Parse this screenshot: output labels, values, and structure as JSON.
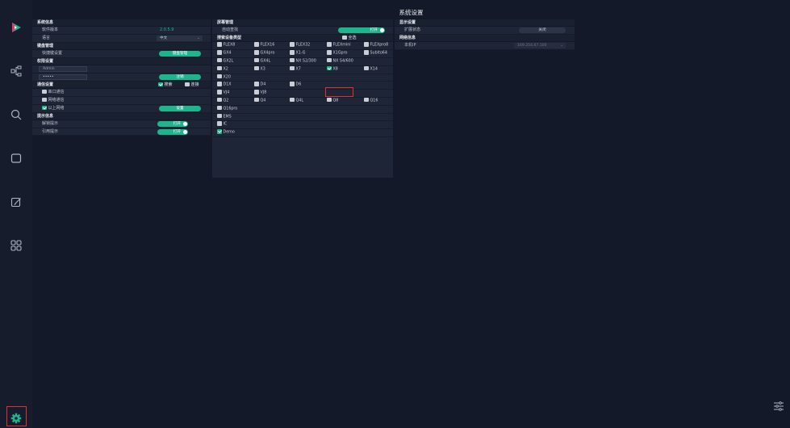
{
  "title": "系统设置",
  "colors": {
    "accent": "#1db58e",
    "bg": "#131928",
    "panel": "#1e2537",
    "highlight": "#e03030"
  },
  "sidebar": {
    "icons": [
      "play-logo-icon",
      "network-tree-icon",
      "search-icon",
      "screen-icon",
      "edit-icon",
      "grid-icon"
    ],
    "settings_icon": "gear-icon"
  },
  "left_panel": {
    "system_info": {
      "header": "系统信息",
      "version_label": "软件版本",
      "version_value": "2.0.5.9",
      "language_label": "语言",
      "language_value": "中文"
    },
    "shortcut": {
      "header": "键盘管理",
      "label": "快捷键设置",
      "button": "键盘管理"
    },
    "permission": {
      "header": "权限设置",
      "username": "Admin",
      "password": "•••••",
      "button": "注销"
    },
    "comm": {
      "header": "通信设置",
      "opt_search": "搜索",
      "opt_connect": "连接",
      "serial": "串口通信",
      "network": "网络通信",
      "ethernet": "以上网络",
      "button": "设置"
    },
    "tips": {
      "header": "提示信息",
      "unlock_label": "解锁提示",
      "unlock_state": "打开",
      "quote_label": "引用提示",
      "quote_state": "打开"
    }
  },
  "mid_panel": {
    "screen_header": "屏幕管理",
    "auto_label": "自动查找",
    "auto_state": "打开",
    "device_header": "搜索设备类型",
    "select_all": "全选",
    "rows": [
      [
        "FLEX8",
        "FLEX16",
        "FLEX32",
        "FLEXmini",
        "FLEXpro8"
      ],
      [
        "GX4",
        "GX4pro",
        "X1-G",
        "X1Gpro",
        "Subito64"
      ],
      [
        "GX2L",
        "GX4L",
        "NX S2/300",
        "NX S4/600"
      ],
      [
        "X2",
        "X3",
        "X7",
        "X8",
        "X14"
      ],
      [
        "X20"
      ],
      [
        "D1X",
        "D4",
        "D6"
      ],
      [
        "VJ4",
        "VJ8"
      ],
      [
        "Q2",
        "Q4",
        "Q4L",
        "Q8",
        "Q16"
      ],
      [
        "Q16pro"
      ],
      [
        "EMS"
      ],
      [
        "IC"
      ],
      [
        "Demo"
      ]
    ]
  },
  "right_panel": {
    "display_header": "显示设置",
    "extend_label": "扩展状态",
    "extend_state": "关闭",
    "network_header": "网络信息",
    "ip_label": "本机IP",
    "ip_value": "169.254.67.100"
  }
}
